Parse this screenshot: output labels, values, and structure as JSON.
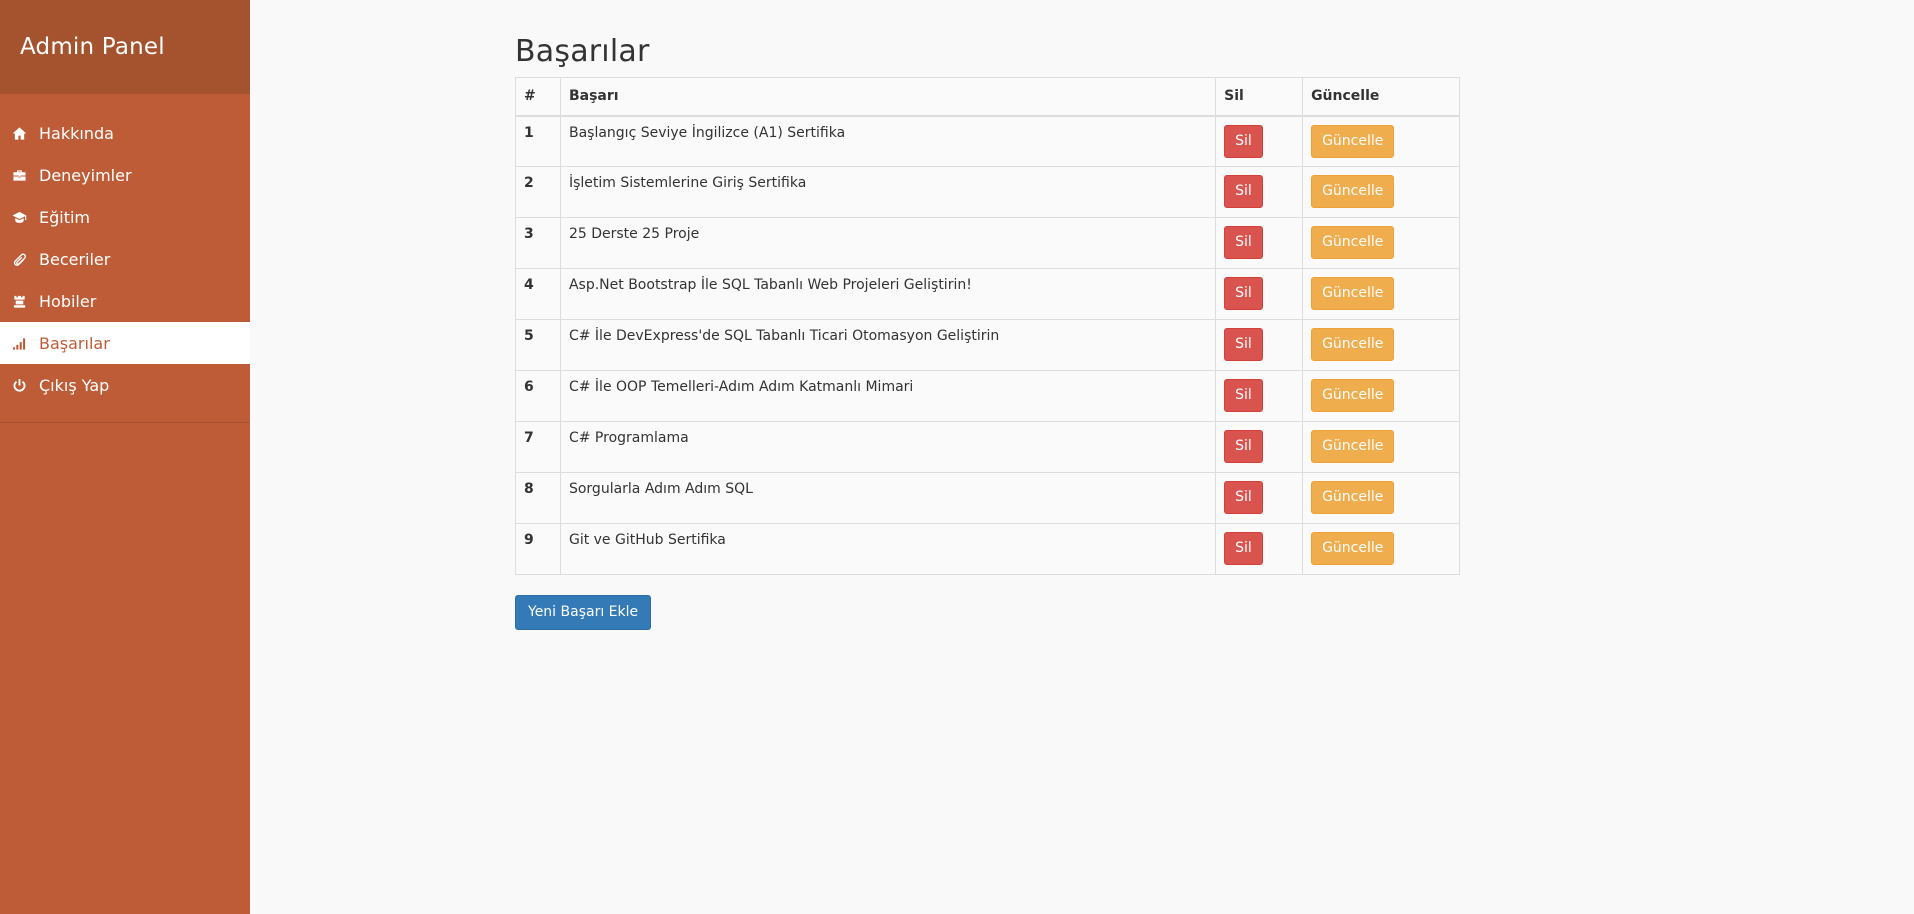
{
  "sidebar": {
    "title": "Admin Panel",
    "items": [
      {
        "label": "Hakkında",
        "icon": "home-icon",
        "active": false
      },
      {
        "label": "Deneyimler",
        "icon": "briefcase-icon",
        "active": false
      },
      {
        "label": "Eğitim",
        "icon": "graduation-cap-icon",
        "active": false
      },
      {
        "label": "Beceriler",
        "icon": "paperclip-icon",
        "active": false
      },
      {
        "label": "Hobiler",
        "icon": "chess-rook-icon",
        "active": false
      },
      {
        "label": "Başarılar",
        "icon": "signal-bars-icon",
        "active": true
      },
      {
        "label": "Çıkış Yap",
        "icon": "power-icon",
        "active": false
      }
    ]
  },
  "main": {
    "title": "Başarılar",
    "columns": [
      "#",
      "Başarı",
      "Sil",
      "Güncelle"
    ],
    "rows": [
      {
        "id": "1",
        "name": "Başlangıç Seviye İngilizce (A1) Sertifika"
      },
      {
        "id": "2",
        "name": "İşletim Sistemlerine Giriş Sertifika"
      },
      {
        "id": "3",
        "name": "25 Derste 25 Proje"
      },
      {
        "id": "4",
        "name": "Asp.Net Bootstrap İle SQL Tabanlı Web Projeleri Geliştirin!"
      },
      {
        "id": "5",
        "name": "C# İle DevExpress'de SQL Tabanlı Ticari Otomasyon Geliştirin"
      },
      {
        "id": "6",
        "name": "C# İle OOP Temelleri-Adım Adım Katmanlı Mimari"
      },
      {
        "id": "7",
        "name": "C# Programlama"
      },
      {
        "id": "8",
        "name": "Sorgularla Adım Adım SQL"
      },
      {
        "id": "9",
        "name": "Git ve GitHub Sertifika"
      }
    ],
    "delete_label": "Sil",
    "update_label": "Güncelle",
    "add_label": "Yeni Başarı Ekle"
  },
  "colors": {
    "sidebar_bg": "#bd5c37",
    "sidebar_header_bg": "#a5522f",
    "danger": "#d9534f",
    "warning": "#f0ad4e",
    "primary": "#337ab7"
  }
}
